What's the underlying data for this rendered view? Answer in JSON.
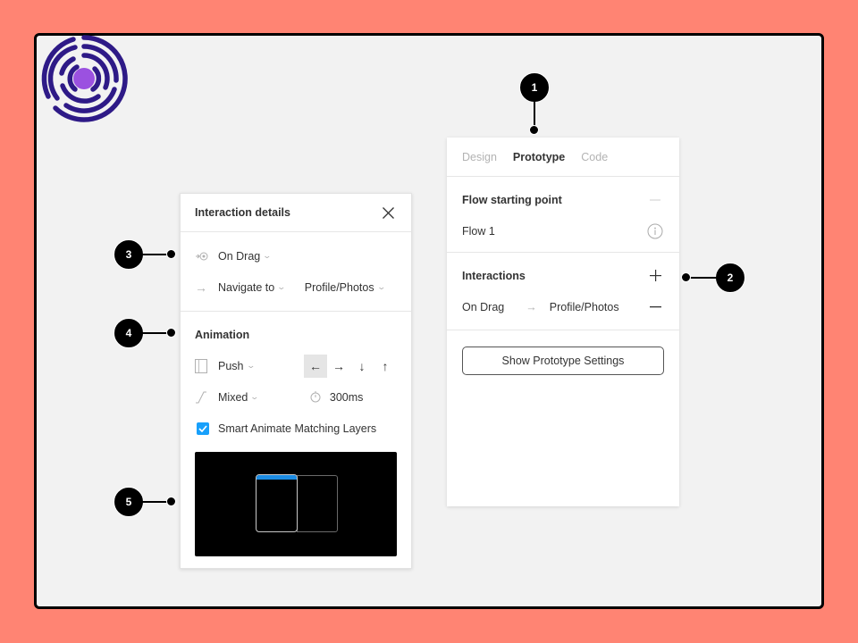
{
  "logo": {
    "name": "maze-logo",
    "ring_color": "#2E1A87",
    "center_color": "#9B51E0"
  },
  "colors": {
    "background": "#FF8473",
    "canvas": "#F2F2F2",
    "accent": "#18A0FB",
    "preview_bar": "#1C8CE3"
  },
  "right_panel": {
    "tabs": [
      {
        "label": "Design",
        "active": false
      },
      {
        "label": "Prototype",
        "active": true
      },
      {
        "label": "Code",
        "active": false
      }
    ],
    "flow_section": {
      "title": "Flow starting point",
      "flow_name": "Flow 1"
    },
    "interactions_section": {
      "title": "Interactions",
      "items": [
        {
          "trigger": "On Drag",
          "destination": "Profile/Photos"
        }
      ]
    },
    "settings_button": "Show Prototype Settings"
  },
  "interaction_details": {
    "title": "Interaction details",
    "trigger": "On Drag",
    "action": "Navigate to",
    "destination": "Profile/Photos",
    "animation": {
      "title": "Animation",
      "type": "Push",
      "directions": [
        "←",
        "→",
        "↓",
        "↑"
      ],
      "active_direction": "←",
      "easing": "Mixed",
      "duration": "300ms",
      "smart_animate_label": "Smart Animate Matching Layers",
      "smart_animate_checked": true
    }
  },
  "callouts": [
    "1",
    "2",
    "3",
    "4",
    "5"
  ]
}
